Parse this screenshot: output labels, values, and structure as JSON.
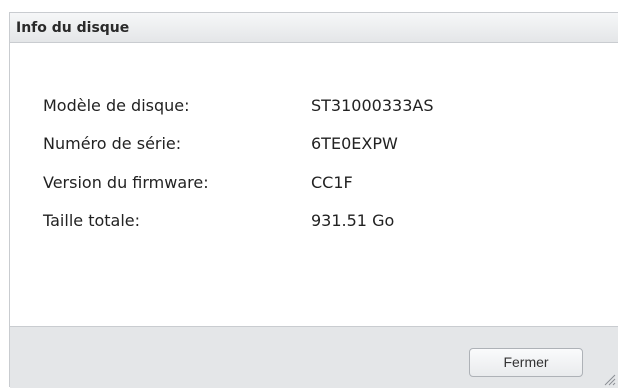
{
  "dialog": {
    "title": "Info du disque",
    "fields": [
      {
        "label": "Modèle de disque:",
        "value": "ST31000333AS"
      },
      {
        "label": "Numéro de série:",
        "value": "6TE0EXPW"
      },
      {
        "label": "Version du firmware:",
        "value": "CC1F"
      },
      {
        "label": "Taille totale:",
        "value": "931.51 Go"
      }
    ],
    "close_label": "Fermer"
  },
  "icons": {
    "resize": "resize-grip-icon"
  },
  "colors": {
    "title_bar": "#e4e6e8",
    "footer": "#e4e6e8",
    "border": "#c9ccd0"
  }
}
